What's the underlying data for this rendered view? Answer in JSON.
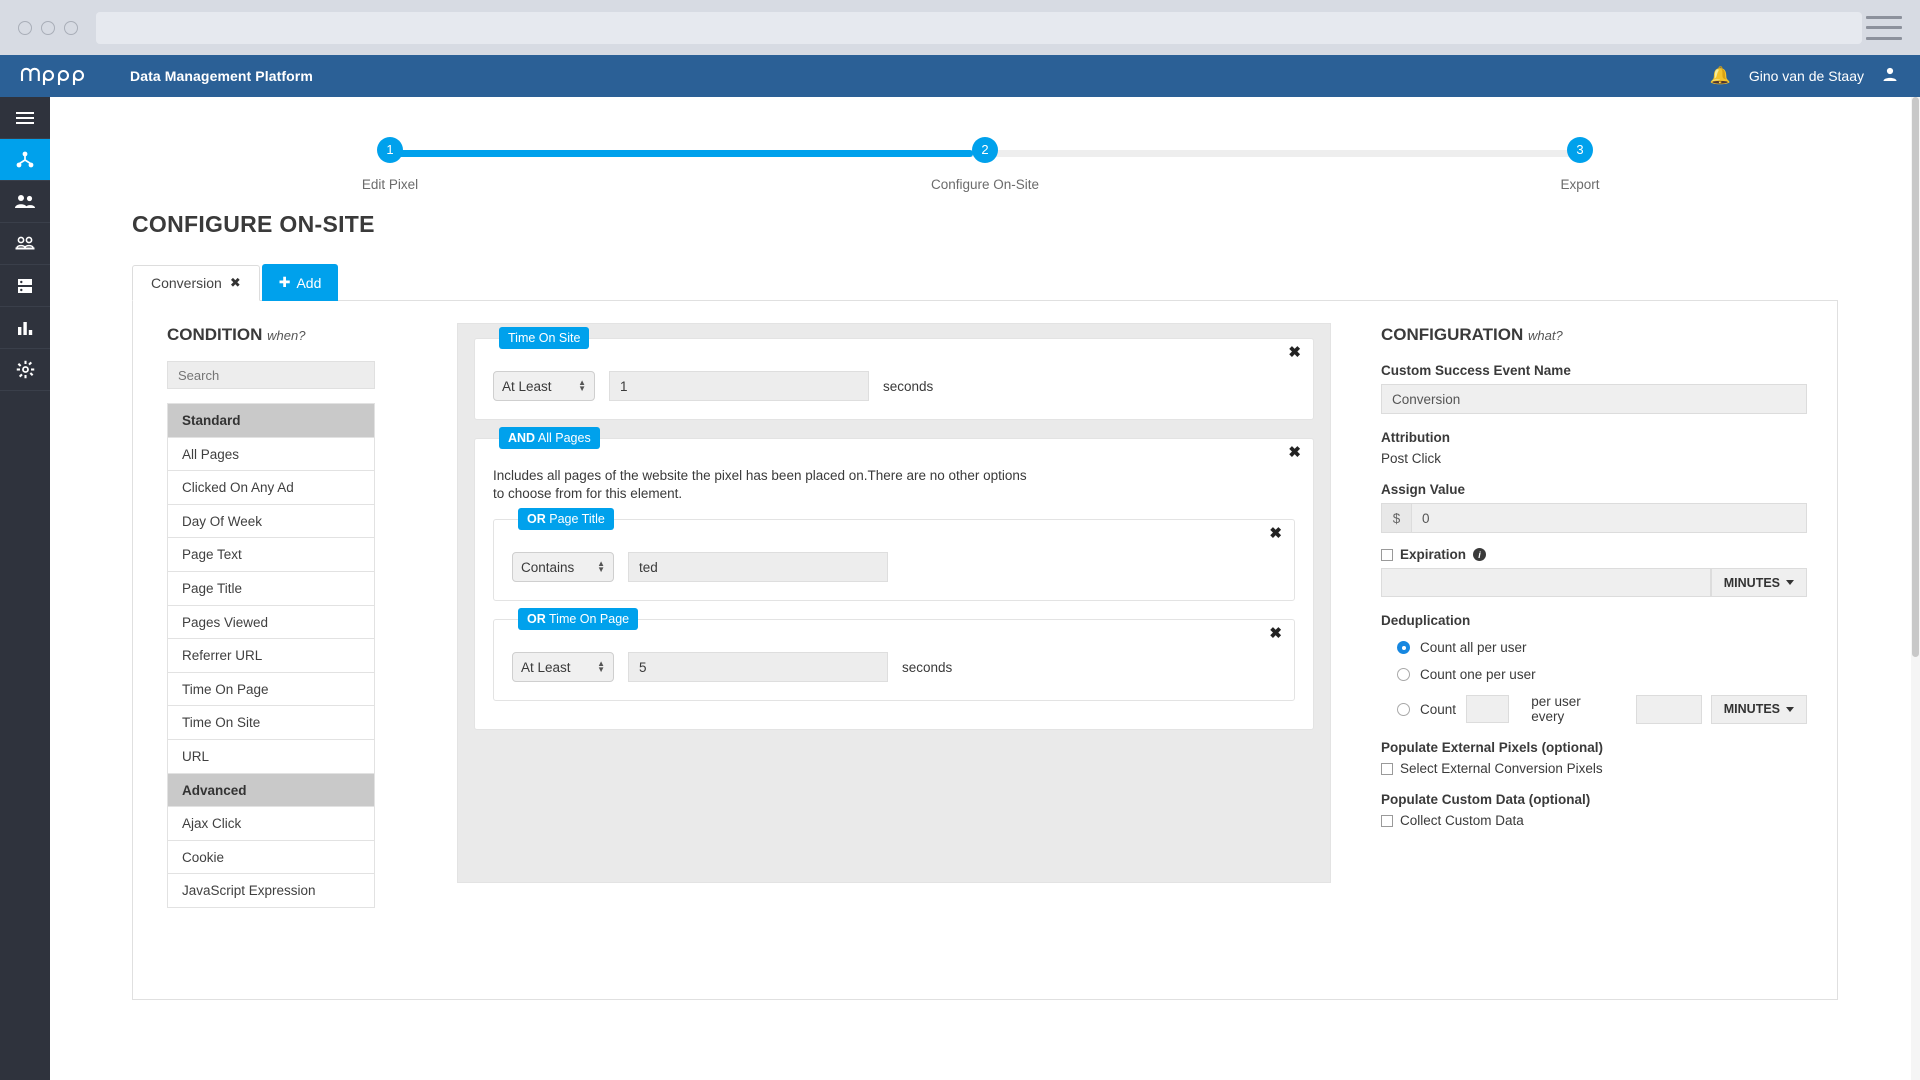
{
  "browser": {
    "url_value": "",
    "menu_icon": "hamburger-icon"
  },
  "topbar": {
    "brand": "mapp",
    "app_name": "Data Management Platform",
    "notification_icon": "bell-icon",
    "user_name": "Gino van de Staay",
    "avatar_icon": "user-icon"
  },
  "rail": {
    "items": [
      {
        "icon": "hamburger-icon",
        "active": false
      },
      {
        "icon": "sitemap-icon",
        "active": true
      },
      {
        "icon": "users-icon",
        "active": false
      },
      {
        "icon": "audience-icon",
        "active": false
      },
      {
        "icon": "server-icon",
        "active": false
      },
      {
        "icon": "bar-chart-icon",
        "active": false
      },
      {
        "icon": "gear-icon",
        "active": false
      }
    ]
  },
  "stepper": {
    "steps": [
      {
        "number": "1",
        "label": "Edit Pixel"
      },
      {
        "number": "2",
        "label": "Configure On-Site"
      },
      {
        "number": "3",
        "label": "Export"
      }
    ],
    "progress_percent": 49
  },
  "page": {
    "title": "CONFIGURE ON-SITE"
  },
  "tabs": {
    "items": [
      {
        "label": "Conversion",
        "close_icon": "close-icon"
      }
    ],
    "add_label": "Add",
    "add_icon": "plus-icon"
  },
  "condition": {
    "heading": "CONDITION",
    "heading_hint": "when?",
    "search_placeholder": "Search",
    "search_value": "",
    "list": [
      {
        "label": "Standard",
        "type": "group"
      },
      {
        "label": "All Pages",
        "type": "item"
      },
      {
        "label": "Clicked On Any Ad",
        "type": "item"
      },
      {
        "label": "Day Of Week",
        "type": "item"
      },
      {
        "label": "Page Text",
        "type": "item"
      },
      {
        "label": "Page Title",
        "type": "item"
      },
      {
        "label": "Pages Viewed",
        "type": "item"
      },
      {
        "label": "Referrer URL",
        "type": "item"
      },
      {
        "label": "Time On Page",
        "type": "item"
      },
      {
        "label": "Time On Site",
        "type": "item"
      },
      {
        "label": "URL",
        "type": "item"
      },
      {
        "label": "Advanced",
        "type": "group"
      },
      {
        "label": "Ajax Click",
        "type": "item"
      },
      {
        "label": "Cookie",
        "type": "item"
      },
      {
        "label": "JavaScript Expression",
        "type": "item"
      }
    ]
  },
  "builder": {
    "rule1": {
      "tag_operator": "",
      "tag_name": "Time On Site",
      "close_icon": "close-icon",
      "select_value": "At Least",
      "input_value": "1",
      "unit": "seconds"
    },
    "rule2": {
      "tag_operator": "AND",
      "tag_name": "All Pages",
      "close_icon": "close-icon",
      "description": "Includes all pages of the website the pixel has been placed on.There are no other options to choose from for this element.",
      "children": [
        {
          "tag_operator": "OR",
          "tag_name": "Page Title",
          "close_icon": "close-icon",
          "select_value": "Contains",
          "input_value": "ted",
          "unit": ""
        },
        {
          "tag_operator": "OR",
          "tag_name": "Time On Page",
          "close_icon": "close-icon",
          "select_value": "At Least",
          "input_value": "5",
          "unit": "seconds"
        }
      ]
    }
  },
  "configuration": {
    "heading": "CONFIGURATION",
    "heading_hint": "what?",
    "event_name_label": "Custom Success Event Name",
    "event_name_value": "Conversion",
    "attribution_label": "Attribution",
    "attribution_value": "Post Click",
    "assign_value_label": "Assign Value",
    "assign_currency_symbol": "$",
    "assign_value": "0",
    "expiration_label": "Expiration",
    "expiration_info_icon": "info-icon",
    "expiration_value": "",
    "expiration_unit": "MINUTES",
    "deduplication_label": "Deduplication",
    "dedup_options": [
      {
        "label": "Count all per user",
        "selected": true
      },
      {
        "label": "Count one per user",
        "selected": false
      },
      {
        "label": "Count",
        "selected": false
      }
    ],
    "dedup_count_value": "",
    "dedup_middle_text": "per user every",
    "dedup_every_value": "",
    "dedup_every_unit": "MINUTES",
    "external_pixels_label": "Populate External Pixels (optional)",
    "external_pixels_checkbox": "Select External Conversion Pixels",
    "custom_data_label": "Populate Custom Data (optional)",
    "custom_data_checkbox": "Collect Custom Data"
  }
}
